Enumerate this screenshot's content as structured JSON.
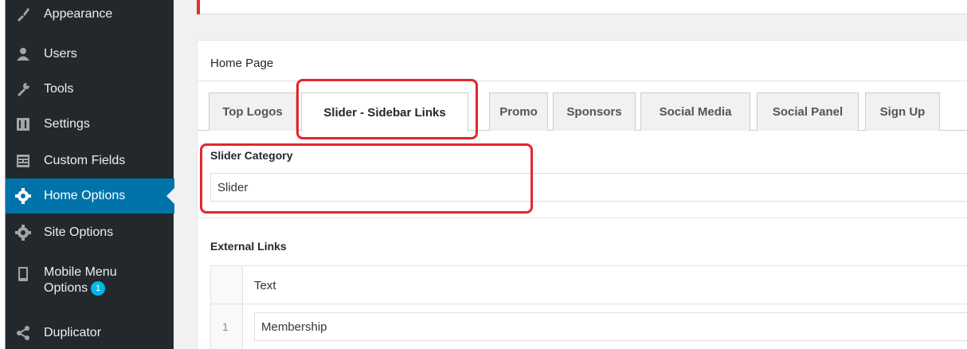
{
  "sidebar": {
    "items": [
      {
        "label": "Appearance",
        "icon": "paintbrush-icon"
      },
      {
        "label": "Users",
        "icon": "users-icon"
      },
      {
        "label": "Tools",
        "icon": "wrench-icon"
      },
      {
        "label": "Settings",
        "icon": "settings-icon"
      },
      {
        "label": "Custom Fields",
        "icon": "custom-fields-icon"
      },
      {
        "label": "Home Options",
        "icon": "gear-icon"
      },
      {
        "label": "Site Options",
        "icon": "gear-icon"
      },
      {
        "label": "Mobile Menu",
        "label2": "Options",
        "badge": "1",
        "icon": "mobile-icon"
      },
      {
        "label": "Duplicator",
        "icon": "share-icon"
      }
    ]
  },
  "panel": {
    "title": "Home Page",
    "tabs": [
      "Top Logos",
      "Slider - Sidebar Links",
      "Promo",
      "Sponsors",
      "Social Media",
      "Social Panel",
      "Sign Up"
    ],
    "active_tab": "Slider - Sidebar Links",
    "slider_category": {
      "label": "Slider Category",
      "value": "Slider"
    },
    "external_links": {
      "label": "External Links",
      "column": "Text",
      "rows": [
        {
          "num": "1",
          "text": "Membership"
        }
      ]
    }
  },
  "colors": {
    "sidebar_bg": "#23282d",
    "active_bg": "#0073aa",
    "highlight": "#e3262d"
  }
}
